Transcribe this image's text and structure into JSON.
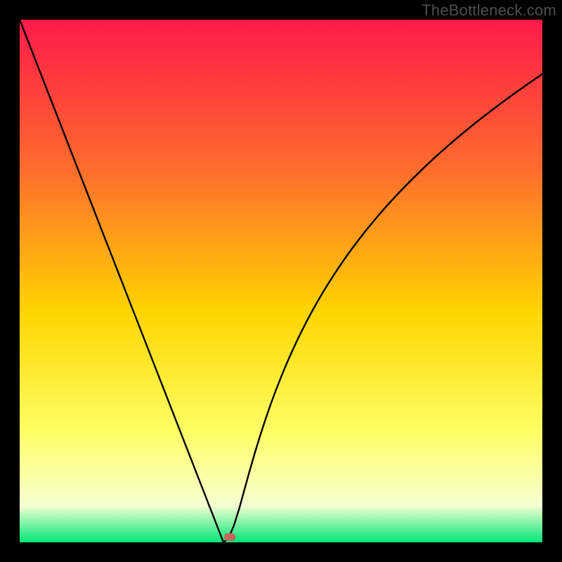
{
  "watermark": "TheBottleneck.com",
  "colors": {
    "frame": "#000000",
    "gradient_top": "#ff1a4a",
    "gradient_mid_upper": "#ff6a2e",
    "gradient_mid": "#ffd500",
    "gradient_mid_lower": "#ffff66",
    "gradient_lower": "#f6ffd2",
    "gradient_bottom": "#00e676",
    "curve": "#000000",
    "marker": "#c9655c"
  },
  "chart_data": {
    "type": "line",
    "title": "",
    "xlabel": "",
    "ylabel": "",
    "xlim": [
      0,
      100
    ],
    "ylim": [
      0,
      100
    ],
    "x": [
      0,
      1,
      2,
      3,
      4,
      5,
      6,
      7,
      8,
      9,
      10,
      11,
      12,
      13,
      14,
      15,
      16,
      17,
      18,
      19,
      20,
      21,
      22,
      23,
      24,
      25,
      26,
      27,
      28,
      29,
      30,
      31,
      32,
      33,
      34,
      35,
      36,
      37,
      38,
      39,
      40,
      41,
      42,
      43,
      44,
      45,
      46,
      47,
      48,
      49,
      50,
      51,
      52,
      53,
      54,
      55,
      56,
      57,
      58,
      59,
      60,
      61,
      62,
      63,
      64,
      65,
      66,
      67,
      68,
      69,
      70,
      71,
      72,
      73,
      74,
      75,
      76,
      77,
      78,
      79,
      80,
      81,
      82,
      83,
      84,
      85,
      86,
      87,
      88,
      89,
      90,
      91,
      92,
      93,
      94,
      95,
      96,
      97,
      98,
      99,
      100
    ],
    "series": [
      {
        "name": "bottleneck-curve",
        "values": [
          100.0,
          97.44,
          94.87,
          92.31,
          89.74,
          87.18,
          84.62,
          82.05,
          79.49,
          76.92,
          74.36,
          71.79,
          69.23,
          66.67,
          64.1,
          61.54,
          58.97,
          56.41,
          53.85,
          51.28,
          48.72,
          46.15,
          43.59,
          41.03,
          38.46,
          35.9,
          33.33,
          30.77,
          28.21,
          25.64,
          23.08,
          20.51,
          17.95,
          15.38,
          12.82,
          10.26,
          7.69,
          5.13,
          2.56,
          0.0,
          0.85,
          3.25,
          6.44,
          10.07,
          13.67,
          17.12,
          20.38,
          23.45,
          26.34,
          29.05,
          31.6,
          34.01,
          36.29,
          38.45,
          40.5,
          42.45,
          44.31,
          46.09,
          47.79,
          49.43,
          51.0,
          52.51,
          53.97,
          55.38,
          56.74,
          58.06,
          59.34,
          60.58,
          61.78,
          62.95,
          64.1,
          65.21,
          66.29,
          67.35,
          68.38,
          69.39,
          70.38,
          71.35,
          72.3,
          73.23,
          74.14,
          75.03,
          75.91,
          76.77,
          77.62,
          78.45,
          79.27,
          80.08,
          80.87,
          81.65,
          82.42,
          83.18,
          83.93,
          84.67,
          85.4,
          86.12,
          86.83,
          87.53,
          88.23,
          88.92,
          89.6
        ]
      }
    ],
    "annotations": [
      {
        "type": "marker",
        "x": 40.2,
        "y": 1.0,
        "shape": "rounded-rect",
        "color": "#c9655c"
      }
    ],
    "grid": false,
    "legend": false
  }
}
